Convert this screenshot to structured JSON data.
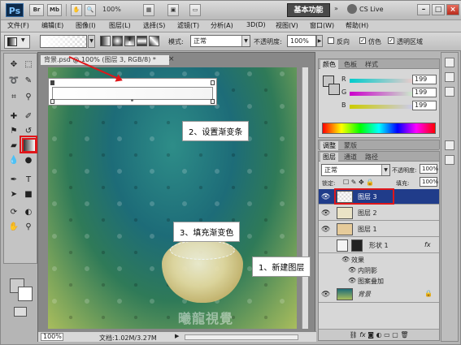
{
  "titlebar": {
    "logo": "Ps",
    "buttons": [
      "Br",
      "Mb"
    ],
    "zoom": "100%",
    "essentials": "基本功能",
    "cslive": "CS Live",
    "win_controls": [
      "–",
      "□",
      "×"
    ]
  },
  "menu": [
    "文件(F)",
    "编辑(E)",
    "图像(I)",
    "图层(L)",
    "选择(S)",
    "滤镜(T)",
    "分析(A)",
    "3D(D)",
    "视图(V)",
    "窗口(W)",
    "帮助(H)"
  ],
  "options": {
    "mode_label": "模式:",
    "mode_value": "正常",
    "opacity_label": "不透明度:",
    "opacity_value": "100%",
    "reverse_label": "反向",
    "dither_label": "仿色",
    "transparency_label": "透明区域"
  },
  "document": {
    "tab_title": "背景.psd @ 100% (图层 3, RGB/8) *",
    "zoom": "100%",
    "doc_info": "文档:1.02M/3.27M"
  },
  "callouts": {
    "step1": "1、新建图层",
    "step2": "2、设置渐变条",
    "step3": "3、填充渐变色"
  },
  "watermark": "曦龍視覺WWW.TLVI.NET",
  "color_panel": {
    "tabs": [
      "颜色",
      "色板",
      "样式"
    ],
    "r_label": "R",
    "g_label": "G",
    "b_label": "B",
    "r": "199",
    "g": "199",
    "b": "199"
  },
  "adjust_panel": {
    "tabs": [
      "调整",
      "蒙版"
    ]
  },
  "layers_panel": {
    "tabs": [
      "图层",
      "通道",
      "路径"
    ],
    "blend": "正常",
    "opacity_label": "不透明度:",
    "opacity": "100%",
    "lock_label": "锁定:",
    "fill_label": "填充:",
    "fill": "100%",
    "layers": [
      {
        "name": "图层 3",
        "selected": true
      },
      {
        "name": "图层 2",
        "selected": false
      },
      {
        "name": "图层 1",
        "selected": false
      },
      {
        "name": "形状 1",
        "selected": false
      },
      {
        "name": "效果",
        "selected": false
      },
      {
        "name": "内阴影",
        "selected": false
      },
      {
        "name": "图案叠加",
        "selected": false
      },
      {
        "name": "背景",
        "selected": false
      }
    ],
    "fx": "fx"
  }
}
